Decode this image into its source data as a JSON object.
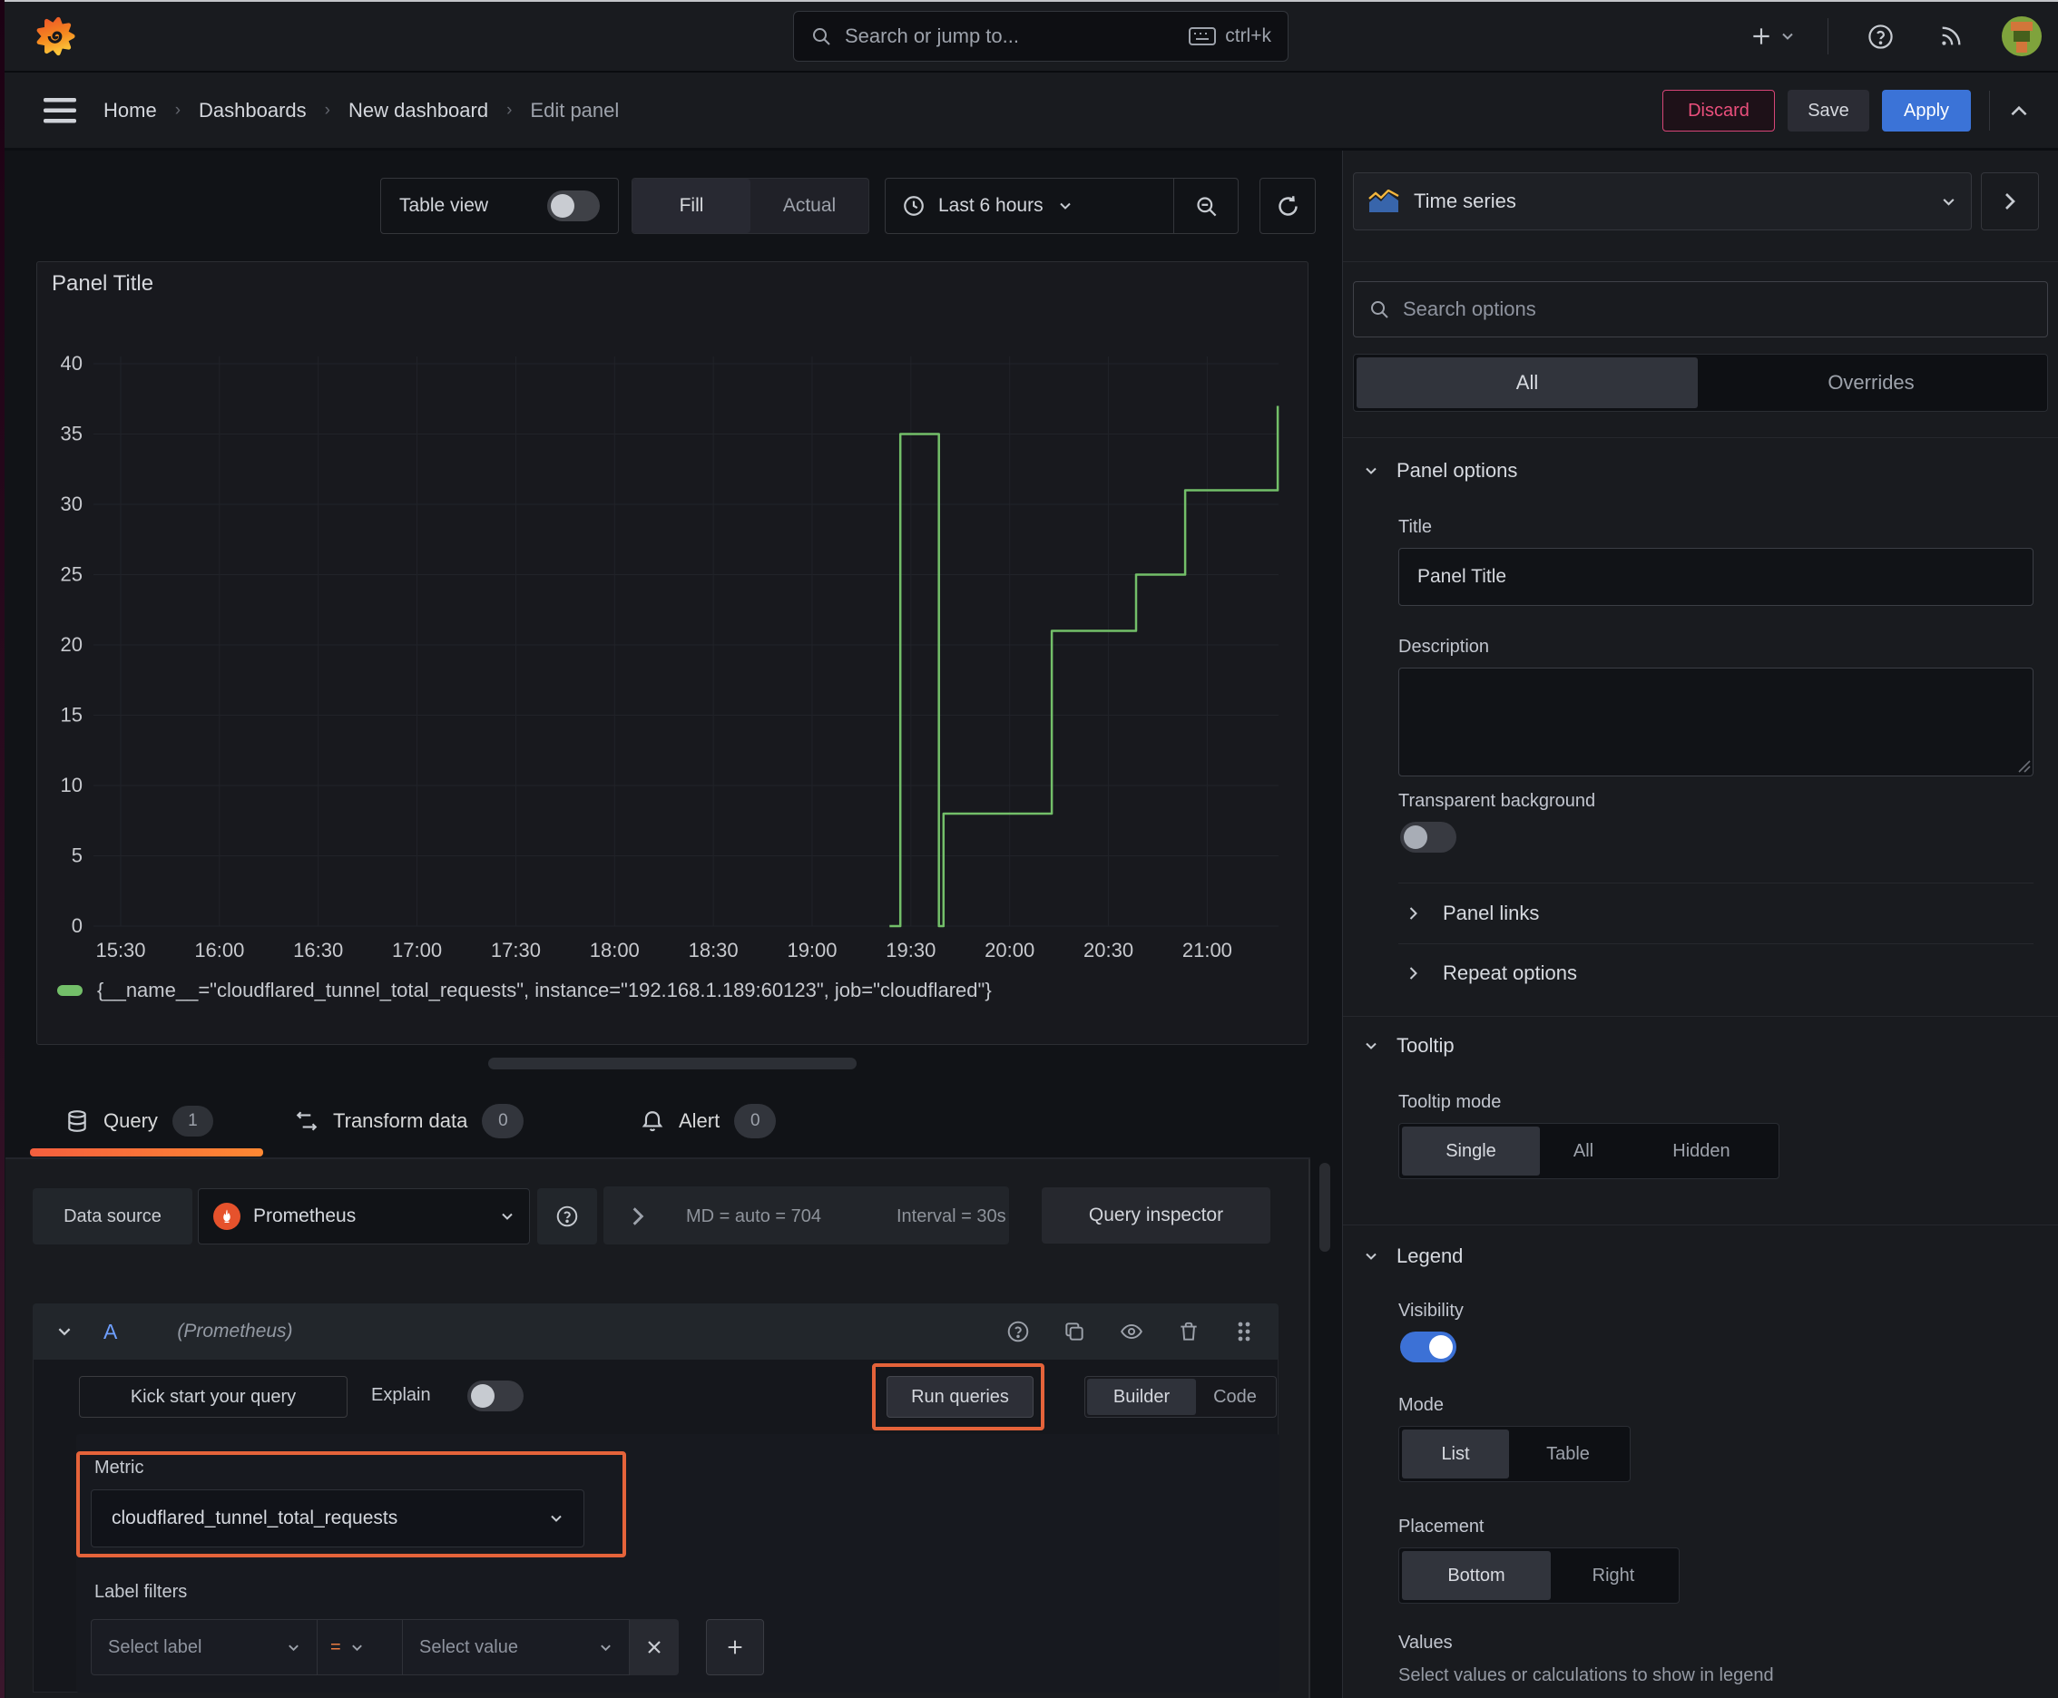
{
  "topbar": {
    "search_placeholder": "Search or jump to...",
    "shortcut": "ctrl+k"
  },
  "breadcrumb": {
    "items": [
      "Home",
      "Dashboards",
      "New dashboard",
      "Edit panel"
    ],
    "discard": "Discard",
    "save": "Save",
    "apply": "Apply"
  },
  "toolbar": {
    "table_view": "Table view",
    "fill": "Fill",
    "actual": "Actual",
    "time_range": "Last 6 hours"
  },
  "panel": {
    "title": "Panel Title"
  },
  "chart_data": {
    "type": "line",
    "title": "Panel Title",
    "ylim": [
      0,
      40
    ],
    "y_ticks": [
      0,
      5,
      10,
      15,
      20,
      25,
      30,
      35,
      40
    ],
    "x_ticks": [
      "15:30",
      "16:00",
      "16:30",
      "17:00",
      "17:30",
      "18:00",
      "18:30",
      "19:00",
      "19:30",
      "20:00",
      "20:30",
      "21:00"
    ],
    "x_tick_step_minutes": 30,
    "grid": true,
    "legend_position": "bottom",
    "series": [
      {
        "name": "{__name__=\"cloudflared_tunnel_total_requests\", instance=\"192.168.1.189:60123\", job=\"cloudflared\"}",
        "color": "#73bf69",
        "points_minutes_value": [
          [
            233.5,
            0
          ],
          [
            236.8,
            0
          ],
          [
            236.8,
            35
          ],
          [
            248.5,
            35
          ],
          [
            248.5,
            0
          ],
          [
            249.9,
            0
          ],
          [
            249.9,
            8
          ],
          [
            282.8,
            8
          ],
          [
            282.8,
            21
          ],
          [
            308.4,
            21
          ],
          [
            308.4,
            25
          ],
          [
            323.3,
            25
          ],
          [
            323.3,
            31
          ],
          [
            351.4,
            31
          ],
          [
            351.4,
            37
          ]
        ]
      }
    ]
  },
  "tabs": [
    {
      "label": "Query",
      "count": "1"
    },
    {
      "label": "Transform data",
      "count": "0"
    },
    {
      "label": "Alert",
      "count": "0"
    }
  ],
  "query": {
    "datasource_label": "Data source",
    "datasource": "Prometheus",
    "md": "MD = auto = 704",
    "interval": "Interval = 30s",
    "inspector": "Query inspector",
    "ref": "A",
    "ref_ds": "(Prometheus)",
    "kickstart": "Kick start your query",
    "explain": "Explain",
    "run": "Run queries",
    "builder": "Builder",
    "code": "Code",
    "metric_label": "Metric",
    "metric": "cloudflared_tunnel_total_requests",
    "label_filters": "Label filters",
    "select_label": "Select label",
    "operator": "=",
    "select_value": "Select value"
  },
  "sidebar": {
    "viz": "Time series",
    "search_placeholder": "Search options",
    "tab_all": "All",
    "tab_overrides": "Overrides",
    "panel_options": "Panel options",
    "title_label": "Title",
    "title_value": "Panel Title",
    "description_label": "Description",
    "transparent_label": "Transparent background",
    "panel_links": "Panel links",
    "repeat_options": "Repeat options",
    "tooltip": "Tooltip",
    "tooltip_mode": "Tooltip mode",
    "tooltip_modes": [
      "Single",
      "All",
      "Hidden"
    ],
    "legend": "Legend",
    "visibility": "Visibility",
    "mode": "Mode",
    "modes": [
      "List",
      "Table"
    ],
    "placement": "Placement",
    "placements": [
      "Bottom",
      "Right"
    ],
    "values_label": "Values",
    "values_hint": "Select values or calculations to show in legend"
  },
  "colors": {
    "accent_orange": "#e8643c",
    "green_series": "#73bf69",
    "blue_primary": "#3b73d7",
    "pink_discard": "#d64577"
  }
}
